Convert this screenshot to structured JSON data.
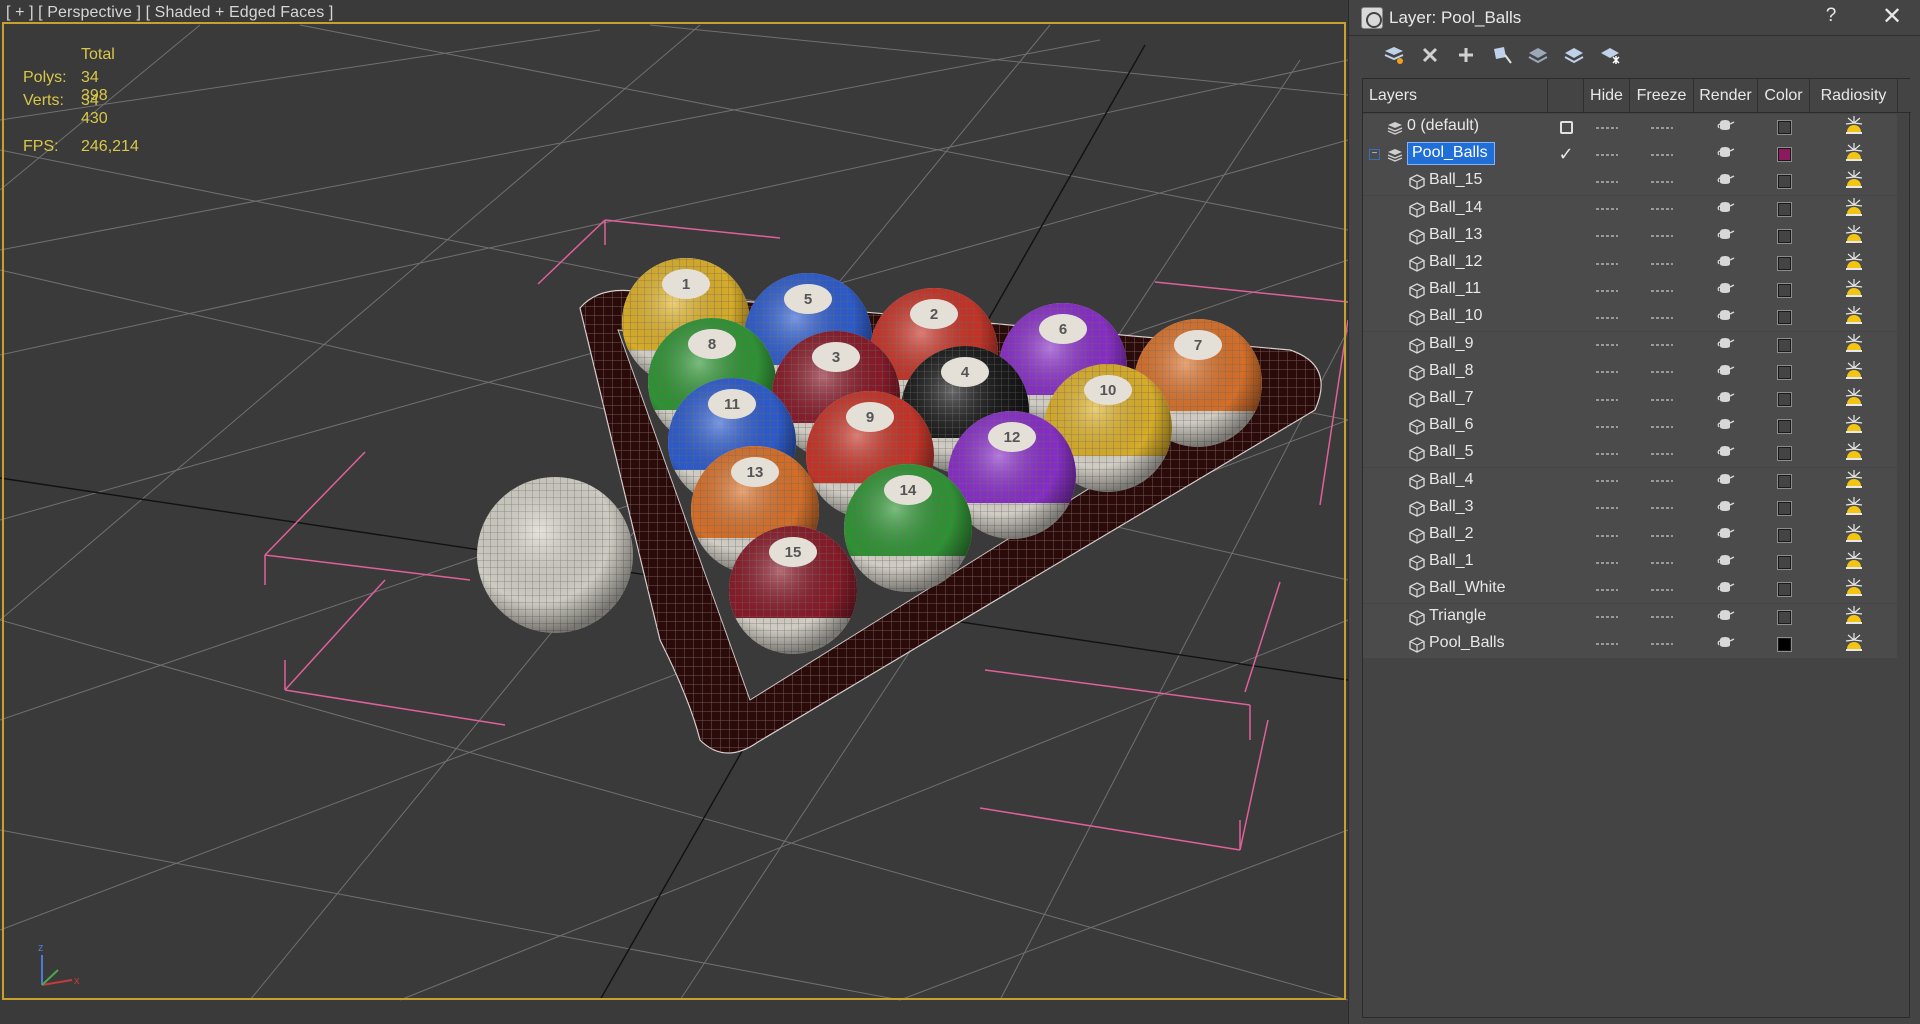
{
  "viewport": {
    "label": "[ + ] [ Perspective ] [ Shaded + Edged Faces ]",
    "stats": {
      "total_label": "Total",
      "polys_label": "Polys:",
      "polys_value": "34 398",
      "verts_label": "Verts:",
      "verts_value": "34 430",
      "fps_label": "FPS:",
      "fps_value": "246,214"
    },
    "axis": {
      "z": "z",
      "x": "x"
    },
    "ball_numbers": [
      "1",
      "5",
      "2",
      "6",
      "7",
      "8",
      "3",
      "4",
      "10",
      "11",
      "9",
      "12",
      "13",
      "14",
      "15"
    ]
  },
  "panel": {
    "title": "Layer: Pool_Balls",
    "help_label": "?",
    "close_label": "✕",
    "toolbar": [
      {
        "name": "create-layer-button",
        "icon": "layer-new-icon"
      },
      {
        "name": "delete-layer-button",
        "icon": "delete-x-icon"
      },
      {
        "name": "add-selected-button",
        "icon": "plus-icon"
      },
      {
        "name": "select-highlighted-button",
        "icon": "select-objects-icon"
      },
      {
        "name": "highlight-selected-button",
        "icon": "layer-highlight-icon"
      },
      {
        "name": "hide-all-layers-button",
        "icon": "layer-hide-icon"
      },
      {
        "name": "freeze-all-layers-button",
        "icon": "layer-freeze-icon"
      }
    ],
    "columns": [
      "Layers",
      "",
      "Hide",
      "Freeze",
      "Render",
      "Color",
      "Radiosity"
    ],
    "rows": [
      {
        "name": "0 (default)",
        "type": "layer",
        "indent": 1,
        "current": "box",
        "color": "#444444"
      },
      {
        "name": "Pool_Balls",
        "type": "layer",
        "indent": 1,
        "current": "check",
        "selected": true,
        "collapsible": true,
        "color": "#8b1a5e"
      },
      {
        "name": "Ball_15",
        "type": "object",
        "indent": 2,
        "color": "#444444"
      },
      {
        "name": "Ball_14",
        "type": "object",
        "indent": 2,
        "color": "#444444"
      },
      {
        "name": "Ball_13",
        "type": "object",
        "indent": 2,
        "color": "#444444"
      },
      {
        "name": "Ball_12",
        "type": "object",
        "indent": 2,
        "color": "#444444"
      },
      {
        "name": "Ball_11",
        "type": "object",
        "indent": 2,
        "color": "#444444"
      },
      {
        "name": "Ball_10",
        "type": "object",
        "indent": 2,
        "color": "#444444"
      },
      {
        "name": "Ball_9",
        "type": "object",
        "indent": 2,
        "color": "#444444"
      },
      {
        "name": "Ball_8",
        "type": "object",
        "indent": 2,
        "color": "#444444"
      },
      {
        "name": "Ball_7",
        "type": "object",
        "indent": 2,
        "color": "#444444"
      },
      {
        "name": "Ball_6",
        "type": "object",
        "indent": 2,
        "color": "#444444"
      },
      {
        "name": "Ball_5",
        "type": "object",
        "indent": 2,
        "color": "#444444"
      },
      {
        "name": "Ball_4",
        "type": "object",
        "indent": 2,
        "color": "#444444"
      },
      {
        "name": "Ball_3",
        "type": "object",
        "indent": 2,
        "color": "#444444"
      },
      {
        "name": "Ball_2",
        "type": "object",
        "indent": 2,
        "color": "#444444"
      },
      {
        "name": "Ball_1",
        "type": "object",
        "indent": 2,
        "color": "#444444"
      },
      {
        "name": "Ball_White",
        "type": "object",
        "indent": 2,
        "color": "#444444"
      },
      {
        "name": "Triangle",
        "type": "object",
        "indent": 2,
        "color": "#444444"
      },
      {
        "name": "Pool_Balls",
        "type": "object",
        "indent": 2,
        "color": "#000000"
      }
    ]
  }
}
